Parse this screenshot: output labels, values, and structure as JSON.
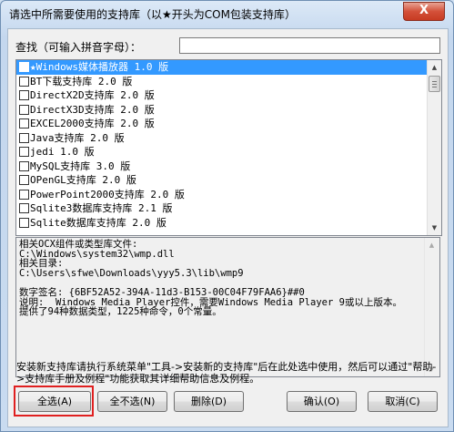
{
  "window": {
    "title": "请选中所需要使用的支持库（以★开头为COM包装支持库）",
    "close_glyph": "X"
  },
  "search": {
    "label": "查找（可输入拼音字母）：",
    "value": ""
  },
  "libraries": [
    "★Windows媒体播放器 1.0 版",
    "BT下载支持库 2.0 版",
    "DirectX2D支持库 2.0 版",
    "DirectX3D支持库 2.0 版",
    "EXCEL2000支持库 2.0 版",
    "Java支持库 2.0 版",
    "jedi 1.0 版",
    "MySQL支持库 3.0 版",
    "OPenGL支持库 2.0 版",
    "PowerPoint2000支持库 2.0 版",
    "Sqlite3数据库支持库 2.1 版",
    "Sqlite数据库支持库 2.0 版"
  ],
  "details": {
    "text": "相关OCX组件或类型库文件:\nC:\\Windows\\system32\\wmp.dll\n相关目录:\nC:\\Users\\sfwe\\Downloads\\yyy5.3\\lib\\wmp9\n\n数字签名: {6BF52A52-394A-11d3-B153-00C04F79FAA6}##0\n说明:  Windows Media Player控件，需要Windows Media Player 9或以上版本。\n提供了94种数据类型，1225种命令，0个常量。"
  },
  "hint": "安装新支持库请执行系统菜单\"工具->安装新的支持库\"后在此处选中使用，然后可以通过\"帮助->支持库手册及例程\"功能获取其详细帮助信息及例程。",
  "buttons": {
    "select_all": "全选(A)",
    "deselect_all": "全不选(N)",
    "delete": "删除(D)",
    "ok": "确认(O)",
    "cancel": "取消(C)"
  },
  "colors": {
    "selection": "#3399ff",
    "highlight_box": "#e02020",
    "close_button": "#d4513a"
  }
}
